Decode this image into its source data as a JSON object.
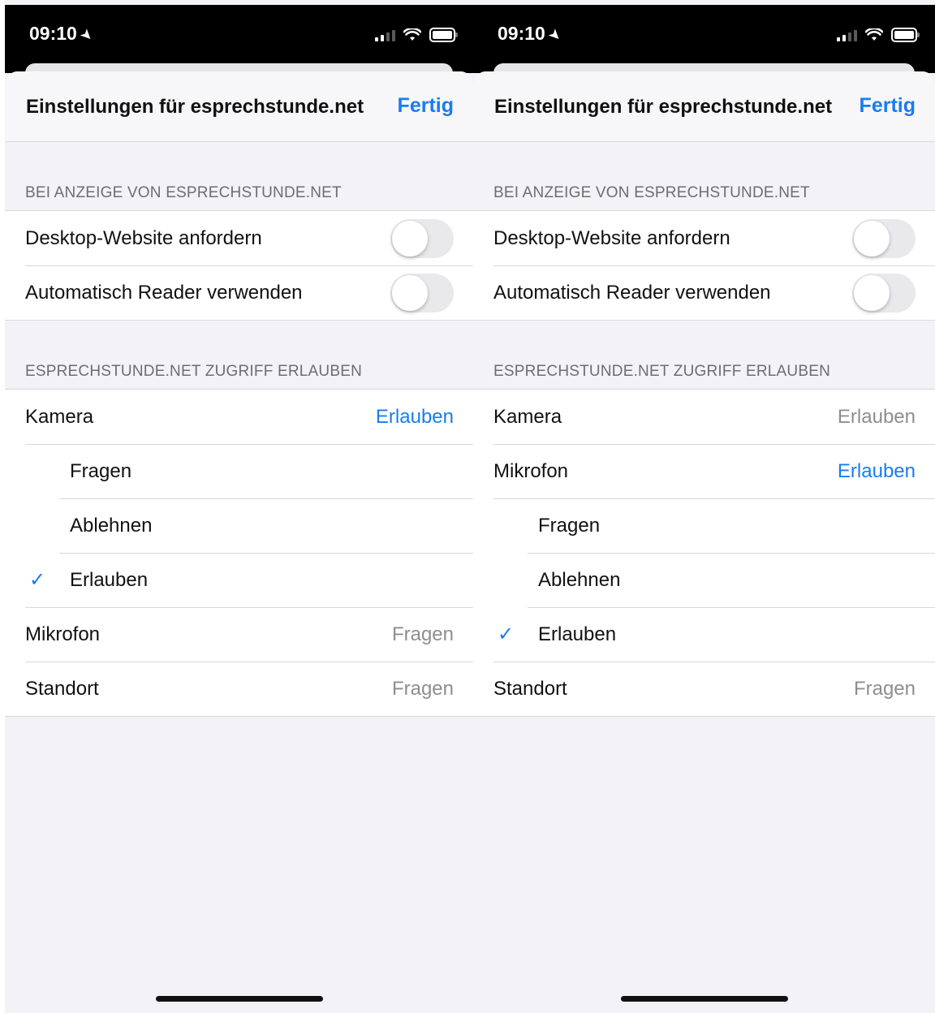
{
  "screens": [
    {
      "status": {
        "time": "09:10"
      },
      "nav": {
        "title": "Einstellungen für esprechstunde.net",
        "done": "Fertig"
      },
      "section1": {
        "header": "BEI ANZEIGE VON ESPRECHSTUNDE.NET",
        "rows": [
          {
            "label": "Desktop-Website anfordern",
            "toggle_on": false
          },
          {
            "label": "Automatisch Reader verwenden",
            "toggle_on": false
          }
        ]
      },
      "section2": {
        "header": "ESPRECHSTUNDE.NET ZUGRIFF ERLAUBEN",
        "camera": {
          "label": "Kamera",
          "value": "Erlauben"
        },
        "options": [
          "Fragen",
          "Ablehnen",
          "Erlauben"
        ],
        "selected_option": "Erlauben",
        "checkmark": "✓",
        "microphone": {
          "label": "Mikrofon",
          "value": "Fragen"
        },
        "location": {
          "label": "Standort",
          "value": "Fragen"
        }
      }
    },
    {
      "status": {
        "time": "09:10"
      },
      "nav": {
        "title": "Einstellungen für esprechstunde.net",
        "done": "Fertig"
      },
      "section1": {
        "header": "BEI ANZEIGE VON ESPRECHSTUNDE.NET",
        "rows": [
          {
            "label": "Desktop-Website anfordern",
            "toggle_on": false
          },
          {
            "label": "Automatisch Reader verwenden",
            "toggle_on": false
          }
        ]
      },
      "section2": {
        "header": "ESPRECHSTUNDE.NET ZUGRIFF ERLAUBEN",
        "camera": {
          "label": "Kamera",
          "value": "Erlauben"
        },
        "microphone": {
          "label": "Mikrofon",
          "value": "Erlauben"
        },
        "options": [
          "Fragen",
          "Ablehnen",
          "Erlauben"
        ],
        "selected_option": "Erlauben",
        "checkmark": "✓",
        "location": {
          "label": "Standort",
          "value": "Fragen"
        }
      }
    }
  ],
  "colors": {
    "accent": "#1a7cf0",
    "secondary_text": "#8e8e93",
    "background": "#f2f2f7"
  },
  "icons": [
    "location-arrow-icon",
    "cellular-signal-icon",
    "wifi-icon",
    "battery-icon",
    "checkmark-icon"
  ]
}
